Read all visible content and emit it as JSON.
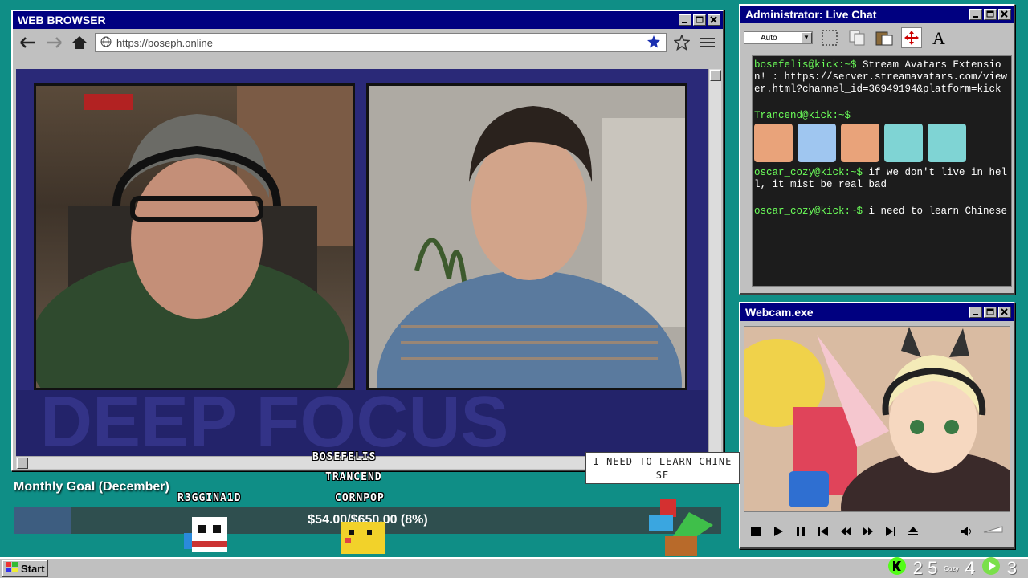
{
  "browser": {
    "title": "WEB BROWSER",
    "url": "https://boseph.online"
  },
  "chat": {
    "title": "Administrator: Live Chat",
    "zoom_option": "Auto",
    "messages": [
      {
        "user": "bosefelis@kick:~$",
        "text": " Stream Avatars Extension! : https://server.streamavatars.com/viewer.html?channel_id=36949194&platform=kick"
      },
      {
        "user": "Trancend@kick:~$",
        "text": ""
      },
      {
        "user": "oscar_cozy@kick:~$",
        "text": " if we don't live in hell, it mist be real bad"
      },
      {
        "user": "oscar_cozy@kick:~$",
        "text": " i need to learn Chinese"
      }
    ]
  },
  "webcam": {
    "title": "Webcam.exe"
  },
  "goal": {
    "title": "Monthly Goal (December)",
    "amount_text": "$54.00/$650.00 (8%)",
    "progress_percent": 8
  },
  "avatars": {
    "names": [
      "BOSEFELIS",
      "TRANCEND",
      "CORNPOP",
      "R3GGINA1D"
    ],
    "speech_bubble": "I NEED TO LEARN CHINE SE"
  },
  "taskbar": {
    "start_label": "Start",
    "tray_a": "2 5",
    "tray_b": "4",
    "tray_c": "3",
    "tray_small": "Cozy"
  },
  "colors": {
    "desktop": "#0f8e86",
    "titlebar": "#000080",
    "chat_user": "#6cff5a"
  }
}
